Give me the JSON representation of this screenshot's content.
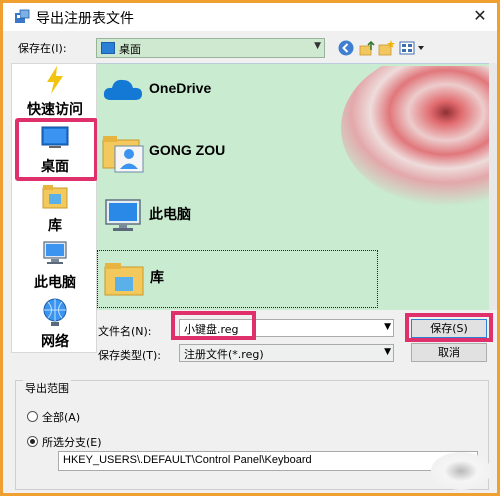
{
  "window": {
    "title": "导出注册表文件",
    "close_glyph": "✕"
  },
  "location": {
    "label": "保存在(I):",
    "value": "桌面"
  },
  "toolbar": {
    "back_icon": "back-arrow-icon",
    "up_icon": "up-folder-icon",
    "new_folder_icon": "new-folder-icon",
    "view_icon": "view-menu-icon"
  },
  "places": [
    {
      "label": "快速访问",
      "icon": "star-lightning-icon"
    },
    {
      "label": "桌面",
      "icon": "desktop-icon"
    },
    {
      "label": "库",
      "icon": "library-icon"
    },
    {
      "label": "此电脑",
      "icon": "computer-icon"
    },
    {
      "label": "网络",
      "icon": "network-icon"
    }
  ],
  "files": [
    {
      "name": "OneDrive",
      "icon": "cloud-icon"
    },
    {
      "name": "GONG ZOU",
      "icon": "user-folder-icon"
    },
    {
      "name": "此电脑",
      "icon": "computer-icon"
    },
    {
      "name": "库",
      "icon": "library-folder-icon"
    }
  ],
  "file_name": {
    "label": "文件名(N):",
    "value": "小键盘.reg"
  },
  "file_type": {
    "label": "保存类型(T):",
    "value": "注册文件(*.reg)"
  },
  "buttons": {
    "save": "保存(S)",
    "cancel": "取消"
  },
  "export_range": {
    "title": "导出范围",
    "all_label": "全部(A)",
    "selected_label": "所选分支(E)",
    "branch_path": "HKEY_USERS\\.DEFAULT\\Control Panel\\Keyboard"
  },
  "colors": {
    "highlight": "#e0306c",
    "window_border": "#f0a030",
    "list_bg": "#c9ebd0"
  }
}
